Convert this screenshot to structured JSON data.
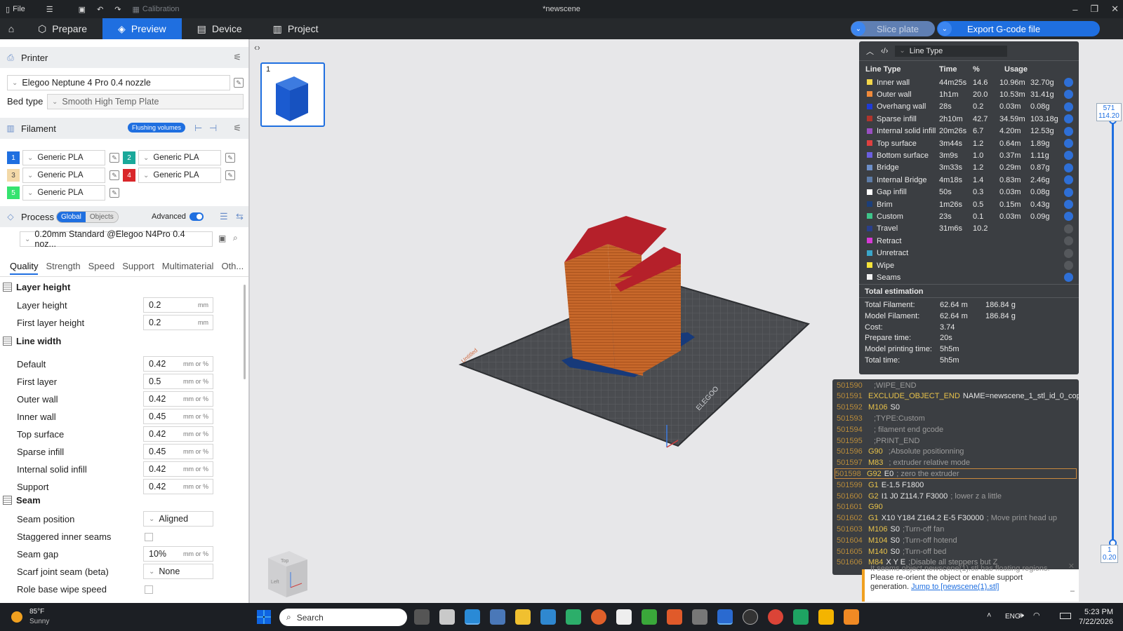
{
  "titlebar": {
    "file": "File",
    "calibration": "Calibration",
    "window_title": "*newscene"
  },
  "tabs": [
    {
      "label": "Prepare"
    },
    {
      "label": "Preview"
    },
    {
      "label": "Device"
    },
    {
      "label": "Project"
    }
  ],
  "actions": {
    "slice": "Slice plate",
    "export": "Export G-code file"
  },
  "printer": {
    "section": "Printer",
    "name": "Elegoo Neptune 4 Pro 0.4 nozzle",
    "bed_label": "Bed type",
    "bed_value": "Smooth High Temp Plate"
  },
  "filament": {
    "section": "Filament",
    "flushing": "Flushing volumes",
    "items": [
      {
        "n": "1",
        "name": "Generic PLA",
        "color": "#1f6fe0"
      },
      {
        "n": "2",
        "name": "Generic PLA",
        "color": "#1aa89a"
      },
      {
        "n": "3",
        "name": "Generic PLA",
        "color": "#f3d9a8"
      },
      {
        "n": "4",
        "name": "Generic PLA",
        "color": "#d9262a"
      },
      {
        "n": "5",
        "name": "Generic PLA",
        "color": "#35e36f"
      }
    ]
  },
  "process": {
    "section": "Process",
    "global": "Global",
    "objects": "Objects",
    "advanced": "Advanced",
    "profile": "0.20mm Standard @Elegoo N4Pro 0.4 noz...",
    "tabs": [
      "Quality",
      "Strength",
      "Speed",
      "Support",
      "Multimaterial",
      "Oth..."
    ]
  },
  "quality": {
    "layer_group": "Layer height",
    "layer_height": {
      "label": "Layer height",
      "value": "0.2",
      "unit": "mm"
    },
    "first_layer_height": {
      "label": "First layer height",
      "value": "0.2",
      "unit": "mm"
    },
    "line_group": "Line width",
    "lines": [
      {
        "label": "Default",
        "value": "0.42",
        "unit": "mm or %"
      },
      {
        "label": "First layer",
        "value": "0.5",
        "unit": "mm or %"
      },
      {
        "label": "Outer wall",
        "value": "0.42",
        "unit": "mm or %"
      },
      {
        "label": "Inner wall",
        "value": "0.45",
        "unit": "mm or %"
      },
      {
        "label": "Top surface",
        "value": "0.42",
        "unit": "mm or %"
      },
      {
        "label": "Sparse infill",
        "value": "0.45",
        "unit": "mm or %"
      },
      {
        "label": "Internal solid infill",
        "value": "0.42",
        "unit": "mm or %"
      },
      {
        "label": "Support",
        "value": "0.42",
        "unit": "mm or %"
      }
    ],
    "seam_group": "Seam",
    "seam_position": {
      "label": "Seam position",
      "value": "Aligned"
    },
    "staggered": {
      "label": "Staggered inner seams"
    },
    "seam_gap": {
      "label": "Seam gap",
      "value": "10%",
      "unit": "mm or %"
    },
    "scarf": {
      "label": "Scarf joint seam (beta)",
      "value": "None"
    },
    "role_wipe": {
      "label": "Role base wipe speed"
    }
  },
  "plate": {
    "number": "1"
  },
  "linetype": {
    "selector": "Line Type",
    "headers": {
      "type": "Line Type",
      "time": "Time",
      "pct": "%",
      "usage": "Usage"
    },
    "rows": [
      {
        "name": "Inner wall",
        "color": "#f3d64a",
        "time": "44m25s",
        "pct": "14.6",
        "len": "10.96m",
        "wt": "32.70g",
        "on": true
      },
      {
        "name": "Outer wall",
        "color": "#f08a3a",
        "time": "1h1m",
        "pct": "20.0",
        "len": "10.53m",
        "wt": "31.41g",
        "on": true
      },
      {
        "name": "Overhang wall",
        "color": "#1f3bd6",
        "time": "28s",
        "pct": "0.2",
        "len": "0.03m",
        "wt": "0.08g",
        "on": true
      },
      {
        "name": "Sparse infill",
        "color": "#b0342c",
        "time": "2h10m",
        "pct": "42.7",
        "len": "34.59m",
        "wt": "103.18g",
        "on": true
      },
      {
        "name": "Internal solid infill",
        "color": "#9a4fc2",
        "time": "20m26s",
        "pct": "6.7",
        "len": "4.20m",
        "wt": "12.53g",
        "on": true
      },
      {
        "name": "Top surface",
        "color": "#e04040",
        "time": "3m44s",
        "pct": "1.2",
        "len": "0.64m",
        "wt": "1.89g",
        "on": true
      },
      {
        "name": "Bottom surface",
        "color": "#6b5fe0",
        "time": "3m9s",
        "pct": "1.0",
        "len": "0.37m",
        "wt": "1.11g",
        "on": true
      },
      {
        "name": "Bridge",
        "color": "#6d8fc9",
        "time": "3m33s",
        "pct": "1.2",
        "len": "0.29m",
        "wt": "0.87g",
        "on": true
      },
      {
        "name": "Internal Bridge",
        "color": "#5d7ca8",
        "time": "4m18s",
        "pct": "1.4",
        "len": "0.83m",
        "wt": "2.46g",
        "on": true
      },
      {
        "name": "Gap infill",
        "color": "#ffffff",
        "time": "50s",
        "pct": "0.3",
        "len": "0.03m",
        "wt": "0.08g",
        "on": true
      },
      {
        "name": "Brim",
        "color": "#1c3f7a",
        "time": "1m26s",
        "pct": "0.5",
        "len": "0.15m",
        "wt": "0.43g",
        "on": true
      },
      {
        "name": "Custom",
        "color": "#3ec48a",
        "time": "23s",
        "pct": "0.1",
        "len": "0.03m",
        "wt": "0.09g",
        "on": true
      },
      {
        "name": "Travel",
        "color": "#2a3f8a",
        "time": "31m6s",
        "pct": "10.2",
        "len": "",
        "wt": "",
        "on": false
      },
      {
        "name": "Retract",
        "color": "#d63ad6",
        "time": "",
        "pct": "",
        "len": "",
        "wt": "",
        "on": false
      },
      {
        "name": "Unretract",
        "color": "#3aa6c9",
        "time": "",
        "pct": "",
        "len": "",
        "wt": "",
        "on": false
      },
      {
        "name": "Wipe",
        "color": "#f5e33a",
        "time": "",
        "pct": "",
        "len": "",
        "wt": "",
        "on": false
      },
      {
        "name": "Seams",
        "color": "#f2f2f2",
        "time": "",
        "pct": "",
        "len": "",
        "wt": "",
        "on": true
      }
    ],
    "total_title": "Total estimation",
    "totals": [
      {
        "label": "Total Filament:",
        "v1": "62.64 m",
        "v2": "186.84 g"
      },
      {
        "label": "Model Filament:",
        "v1": "62.64 m",
        "v2": "186.84 g"
      },
      {
        "label": "Cost:",
        "v1": "3.74",
        "v2": ""
      },
      {
        "label": "Prepare time:",
        "v1": "20s",
        "v2": ""
      },
      {
        "label": "Model printing time:",
        "v1": "5h5m",
        "v2": ""
      },
      {
        "label": "Total time:",
        "v1": "5h5m",
        "v2": ""
      }
    ]
  },
  "gcode": [
    {
      "n": "501590",
      "cmd": "",
      "args": "",
      "cmt": ";WIPE_END"
    },
    {
      "n": "501591",
      "cmd": "EXCLUDE_OBJECT_END",
      "args": "NAME=newscene_1_stl_id_0_copy_0",
      "cmt": ""
    },
    {
      "n": "501592",
      "cmd": "M106",
      "args": "S0",
      "cmt": ""
    },
    {
      "n": "501593",
      "cmd": "",
      "args": "",
      "cmt": ";TYPE:Custom"
    },
    {
      "n": "501594",
      "cmd": "",
      "args": "",
      "cmt": "; filament end gcode"
    },
    {
      "n": "501595",
      "cmd": "",
      "args": "",
      "cmt": ";PRINT_END"
    },
    {
      "n": "501596",
      "cmd": "G90",
      "args": "",
      "cmt": ";Absolute positionning"
    },
    {
      "n": "501597",
      "cmd": "M83",
      "args": "",
      "cmt": "; extruder relative mode"
    },
    {
      "n": "501598",
      "cmd": "G92",
      "args": "E0",
      "cmt": "; zero the extruder"
    },
    {
      "n": "501599",
      "cmd": "G1",
      "args": "E-1.5 F1800",
      "cmt": ""
    },
    {
      "n": "501600",
      "cmd": "G2",
      "args": "I1 J0 Z114.7 F3000",
      "cmt": "; lower z a little"
    },
    {
      "n": "501601",
      "cmd": "G90",
      "args": "",
      "cmt": ""
    },
    {
      "n": "501602",
      "cmd": "G1",
      "args": "X10 Y184 Z164.2 E-5 F30000",
      "cmt": "; Move print head up"
    },
    {
      "n": "501603",
      "cmd": "M106",
      "args": "S0",
      "cmt": ";Turn-off fan"
    },
    {
      "n": "501604",
      "cmd": "M104",
      "args": "S0",
      "cmt": ";Turn-off hotend"
    },
    {
      "n": "501605",
      "cmd": "M140",
      "args": "S0",
      "cmt": ";Turn-off bed"
    },
    {
      "n": "501606",
      "cmd": "M84",
      "args": "X Y E",
      "cmt": ";Disable all steppers but Z"
    }
  ],
  "warning": {
    "text1": "It seems object newscene(1).stl has floating regions.",
    "text2": "Please re-orient the object or enable support",
    "text3": "generation.",
    "link": "Jump to [newscene(1).stl]"
  },
  "slider": {
    "top_a": "571",
    "top_b": "114.20",
    "bot_a": "1",
    "bot_b": "0.20"
  },
  "weather": {
    "temp": "85°F",
    "cond": "Sunny"
  },
  "taskbar": {
    "search": "Search",
    "lang": "ENG",
    "time": "5:23 PM",
    "date": "7/22/2026"
  }
}
